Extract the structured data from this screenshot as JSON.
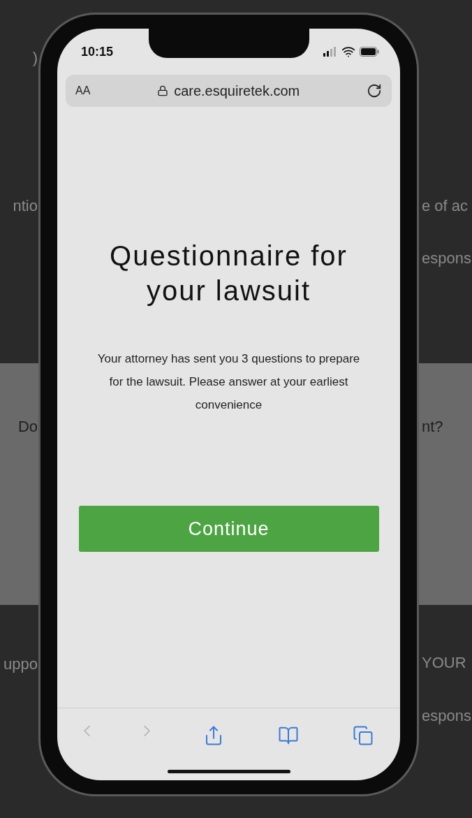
{
  "background": {
    "left": [
      ")",
      "ntio",
      "Do",
      "uppo"
    ],
    "right": [
      "e of ac",
      "espons",
      "nt?",
      "YOUR",
      "espons"
    ]
  },
  "status_bar": {
    "time": "10:15"
  },
  "address_bar": {
    "text_size": "AA",
    "url": "care.esquiretek.com"
  },
  "dialog": {
    "title": "Questionnaire for your lawsuit",
    "message": "Your attorney has sent you 3 questions to prepare for the lawsuit. Please answer at your earliest convenience",
    "button": "Continue"
  },
  "toolbar": [
    {
      "kind": "back",
      "disabled": true
    },
    {
      "kind": "forward",
      "disabled": true
    },
    {
      "kind": "share",
      "disabled": false
    },
    {
      "kind": "bookmarks",
      "disabled": false
    },
    {
      "kind": "tabs",
      "disabled": false
    }
  ]
}
